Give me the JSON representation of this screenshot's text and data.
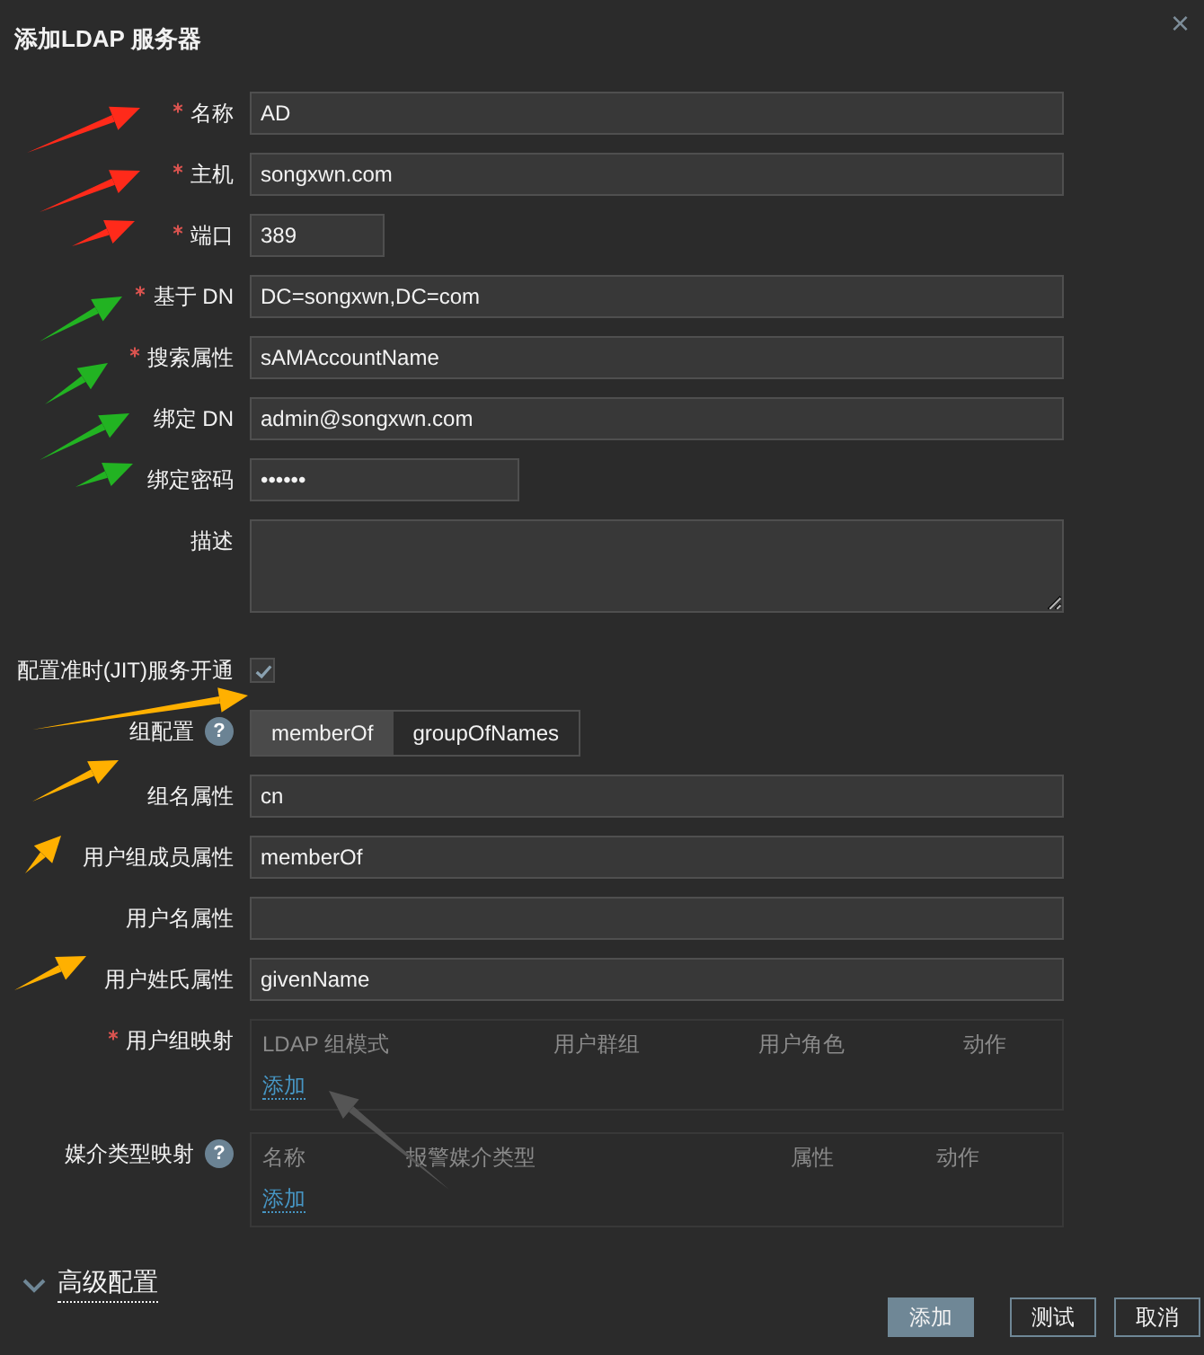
{
  "dialog": {
    "title": "添加LDAP 服务器",
    "close": "×"
  },
  "fields": [
    {
      "kind": "text",
      "label": "名称",
      "required": true,
      "value": "AD"
    },
    {
      "kind": "text",
      "label": "主机",
      "required": true,
      "value": "songxwn.com"
    },
    {
      "kind": "short",
      "label": "端口",
      "required": true,
      "value": "389"
    },
    {
      "kind": "text",
      "label": "基于 DN",
      "required": true,
      "value": "DC=songxwn,DC=com"
    },
    {
      "kind": "text",
      "label": "搜索属性",
      "required": true,
      "value": "sAMAccountName"
    },
    {
      "kind": "text",
      "label": "绑定 DN",
      "required": false,
      "value": "admin@songxwn.com"
    },
    {
      "kind": "password",
      "label": "绑定密码",
      "required": false,
      "value": "••••••"
    },
    {
      "kind": "textarea",
      "label": "描述",
      "required": false
    },
    {
      "kind": "checkbox",
      "label": "配置准时(JIT)服务开通",
      "required": false,
      "checked": true
    },
    {
      "kind": "segmented",
      "label": "组配置",
      "required": false,
      "help": "?",
      "options": [
        {
          "label": "memberOf",
          "selected": true
        },
        {
          "label": "groupOfNames",
          "selected": false
        }
      ]
    },
    {
      "kind": "text",
      "label": "组名属性",
      "required": false,
      "value": "cn"
    },
    {
      "kind": "text",
      "label": "用户组成员属性",
      "required": false,
      "value": "memberOf"
    },
    {
      "kind": "text",
      "label": "用户名属性",
      "required": false
    },
    {
      "kind": "text",
      "label": "用户姓氏属性",
      "required": false,
      "value": "givenName"
    },
    {
      "kind": "table",
      "label": "用户组映射",
      "required": true,
      "columns": [
        "LDAP 组模式",
        "用户群组",
        "用户角色",
        "动作"
      ],
      "link": "添加"
    },
    {
      "kind": "table2",
      "label": "媒介类型映射",
      "required": false,
      "help": "?",
      "columns": [
        "名称",
        "报警媒介类型",
        "属性",
        "动作"
      ],
      "link": "添加"
    }
  ],
  "advanced": {
    "label": "高级配置",
    "expanded": false
  },
  "buttons": [
    {
      "label": "添加",
      "primary": true
    },
    {
      "label": "测试",
      "primary": false
    },
    {
      "label": "取消",
      "primary": false
    }
  ]
}
